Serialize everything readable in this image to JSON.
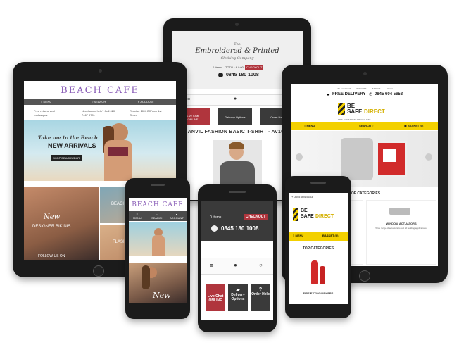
{
  "colors": {
    "accent": "#b0353d",
    "yellow": "#f3d000",
    "beach": "#8b5fb8",
    "dark": "#2d2d2d"
  },
  "embroidered": {
    "logo_small": "The",
    "logo_main": "Embroidered & Printed",
    "logo_sub": "Clothing Company",
    "basket": "0 Items",
    "total": "TOTAL: £ 0.00",
    "checkout": "CHECKOUT",
    "phone": "0845 180 1008",
    "live_chat": "Live Chat",
    "online": "ONLINE",
    "delivery": "Delivery Options",
    "order_help": "Order Help",
    "product_title": "ANVIL FASHION BASIC T-SHIRT - AV105"
  },
  "beach": {
    "logo": "BEACH CAFE",
    "menu": "MENU",
    "search": "SEARCH",
    "account": "ACCOUNT",
    "returns": "Free returns and exchanges",
    "help": "Need some help? Call 020 7467 0791",
    "receive": "Receive 10% Off Your 1st Order",
    "hero_script": "Take me to the Beach",
    "hero_title": "NEW ARRIVALS",
    "shop_btn": "SHOP BEACHWEAR",
    "tile1_script": "New",
    "tile1": "DESIGNER BIKINIS",
    "tile2": "BEACH KAFTANS",
    "tile3": "FLASH TATTOOS",
    "tile4": "FOLLOW US ON",
    "phone_hero": "New"
  },
  "safe": {
    "top_links": [
      "MY ACCOUNT",
      "WISHLIST",
      "BASKET",
      "LOGIN"
    ],
    "free_delivery": "FREE DELIVERY",
    "phone": "0845 604 5653",
    "logo1": "BE",
    "logo2": "SAFE",
    "logo3": "DIRECT",
    "tagline": "FIRE AND SAFETY SPECIALISTS",
    "menu": "MENU",
    "search": "SEARCH",
    "basket": "BASKET (0)",
    "top_categories": "TOP CATEGORIES",
    "cat_window": "WINDOW ACTUATORS",
    "cat_window_desc": "Wide range of actuators to suit all building applications.",
    "fire_ext": "FIRE EXTINGUISHERS",
    "phone_link": "+ 0845 604 5653"
  }
}
